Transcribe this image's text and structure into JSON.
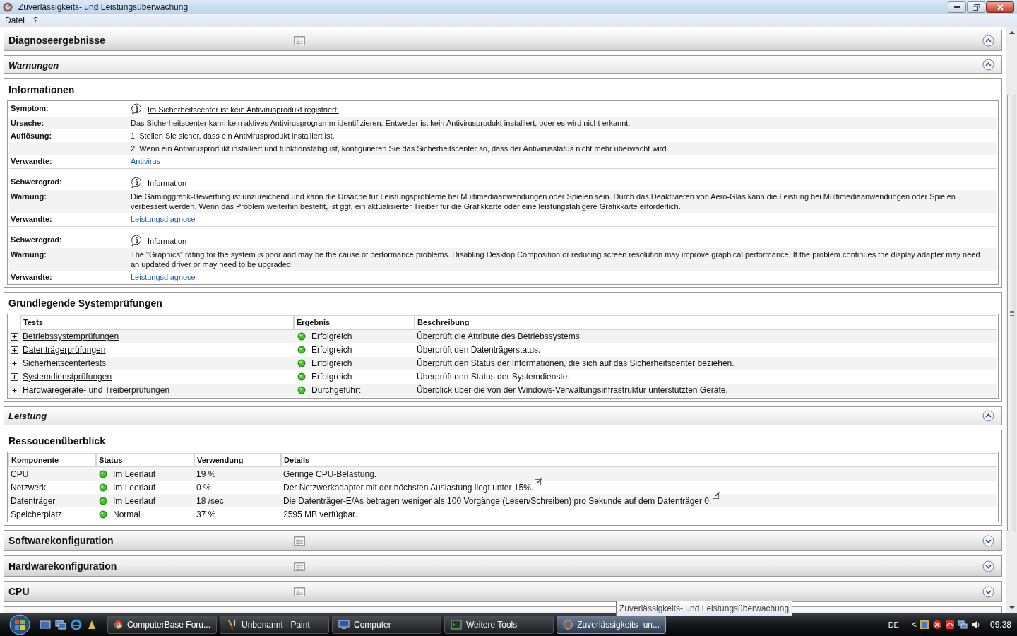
{
  "window": {
    "title": "Zuverlässigkeits- und Leistungsüberwachung"
  },
  "menu": [
    "Datei",
    "?"
  ],
  "sections": [
    {
      "kind": "category",
      "title": "Diagnoseergebnisse",
      "expanded": true
    },
    {
      "kind": "subcategory",
      "title": "Warnungen",
      "expanded": true
    },
    {
      "kind": "info",
      "title": "Informationen",
      "groups": [
        {
          "rows": [
            {
              "kind": "icon_link",
              "label": "Symptom:",
              "text": "Im Sicherheitscenter ist kein Antivirusprodukt registriert."
            },
            {
              "kind": "text",
              "label": "Ursache:",
              "text": "Das Sicherheitscenter kann kein aktives Antivirusprogramm identifizieren. Entweder ist kein Antivirusprodukt installiert, oder es wird nicht erkannt."
            },
            {
              "kind": "text",
              "label": "Auflösung:",
              "text": "1. Stellen Sie sicher, dass ein Antivirusprodukt installiert ist."
            },
            {
              "kind": "text",
              "text": "2. Wenn ein Antivirusprodukt installiert und funktionsfähig ist, konfigurieren Sie das Sicherheitscenter so, dass der Antivirusstatus nicht mehr überwacht wird."
            },
            {
              "kind": "link",
              "label": "Verwandte:",
              "text": "Antivirus"
            }
          ]
        },
        {
          "rows": [
            {
              "kind": "icon_link",
              "label": "Schweregrad:",
              "text": "Information"
            },
            {
              "kind": "text",
              "label": "Warnung:",
              "text": "Die Gaminggrafik-Bewertung ist unzureichend und kann die Ursache für Leistungsprobleme bei Multimediaanwendungen oder Spielen sein. Durch das Deaktivieren von Aero-Glas kann die Leistung bei Multimediaanwendungen oder Spielen verbessert werden. Wenn das Problem weiterhin besteht, ist ggf. ein aktualisierter Treiber für die Grafikkarte oder eine leistungsfähigere Grafikkarte erforderlich."
            },
            {
              "kind": "link",
              "label": "Verwandte:",
              "text": "Leistungsdiagnose"
            }
          ]
        },
        {
          "rows": [
            {
              "kind": "icon_link",
              "label": "Schweregrad:",
              "text": "Information"
            },
            {
              "kind": "text",
              "label": "Warnung:",
              "text": "The \"Graphics\" rating for the system is poor and may be the cause of performance problems. Disabling Desktop Composition or reducing screen resolution may improve graphical performance. If the problem continues the display adapter may need an updated driver or may need to be upgraded."
            },
            {
              "kind": "link",
              "label": "Verwandte:",
              "text": "Leistungsdiagnose"
            }
          ]
        }
      ]
    },
    {
      "kind": "tests",
      "title": "Grundlegende Systemprüfungen",
      "columns": [
        "Tests",
        "Ergebnis",
        "Beschreibung"
      ],
      "rows": [
        {
          "name": "Betriebssystemprüfungen",
          "expanded": false,
          "result": "Erfolgreich",
          "description": "Überprüft die Attribute des Betriebssystems."
        },
        {
          "name": "Datenträgerprüfungen",
          "expanded": false,
          "result": "Erfolgreich",
          "description": "Überprüft den Datenträgerstatus."
        },
        {
          "name": "Sicherheitscentertests",
          "expanded": false,
          "result": "Erfolgreich",
          "description": "Überprüft den Status der Informationen, die sich auf das Sicherheitscenter beziehen."
        },
        {
          "name": "Systemdienstprüfungen",
          "expanded": false,
          "result": "Erfolgreich",
          "description": "Überprüft den Status der Systemdienste."
        },
        {
          "name": "Hardwaregeräte- und Treiberprüfungen",
          "expanded": false,
          "result": "Durchgeführt",
          "description": "Überblick über die von der Windows-Verwaltungsinfrastruktur unterstützten Geräte."
        }
      ]
    },
    {
      "kind": "subcategory",
      "title": "Leistung",
      "expanded": true
    },
    {
      "kind": "resources",
      "title": "Ressoucenüberblick",
      "columns": [
        "Komponente",
        "Status",
        "Verwendung",
        "Details"
      ],
      "rows": [
        {
          "component": "CPU",
          "status": "Im Leerlauf",
          "usage": "19 %",
          "details": "Geringe CPU-Belastung.",
          "note": false
        },
        {
          "component": "Netzwerk",
          "status": "Im Leerlauf",
          "usage": "0 %",
          "details": "Der Netzwerkadapter mit der höchsten Auslastung liegt unter 15%.",
          "note": true
        },
        {
          "component": "Datenträger",
          "status": "Im Leerlauf",
          "usage": "18 /sec",
          "details": "Die Datenträger-E/As betragen weniger als 100 Vorgänge (Lesen/Schreiben) pro Sekunde auf dem Datenträger 0.",
          "note": true
        },
        {
          "component": "Speicherplatz",
          "status": "Normal",
          "usage": "37 %",
          "details": "2595 MB verfügbar.",
          "note": false
        }
      ]
    },
    {
      "kind": "category",
      "title": "Softwarekonfiguration",
      "expanded": false
    },
    {
      "kind": "category",
      "title": "Hardwarekonfiguration",
      "expanded": false
    },
    {
      "kind": "category",
      "title": "CPU",
      "expanded": false
    },
    {
      "kind": "category"
    }
  ],
  "taskbar": {
    "tasks": [
      {
        "label": "ComputerBase Foru...",
        "selected": false
      },
      {
        "label": "Unbenannt - Paint",
        "selected": false
      },
      {
        "label": "Computer",
        "selected": false
      },
      {
        "label": "Weitere Tools",
        "selected": false
      },
      {
        "label": "Zuverlässigkeits- un...",
        "selected": true
      }
    ],
    "language": "DE",
    "tray_arrow": "<",
    "clock": "09:38"
  },
  "tooltip": "Zuverlässigkeits- und Leistungsüberwachung"
}
